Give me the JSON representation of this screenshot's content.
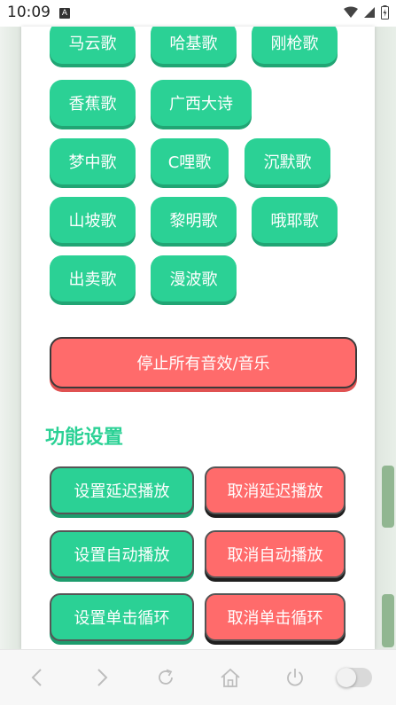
{
  "status_bar": {
    "time": "10:09",
    "notification_letter": "A"
  },
  "songs": [
    "马云歌",
    "哈基歌",
    "刚枪歌",
    "香蕉歌",
    "广西大诗",
    "梦中歌",
    "C哩歌",
    "沉默歌",
    "山坡歌",
    "黎明歌",
    "哦耶歌",
    "出卖歌",
    "漫波歌"
  ],
  "stop_all": "停止所有音效/音乐",
  "settings": {
    "title": "功能设置",
    "buttons": [
      {
        "set": "设置延迟播放",
        "cancel": "取消延迟播放"
      },
      {
        "set": "设置自动播放",
        "cancel": "取消自动播放"
      },
      {
        "set": "设置单击循环",
        "cancel": "取消单击循环"
      }
    ]
  },
  "nav_icons": [
    "back-icon",
    "forward-icon",
    "reload-icon",
    "home-icon",
    "power-icon",
    "toggle-switch"
  ],
  "colors": {
    "accent_green": "#2bd195",
    "accent_red": "#ff6b6b"
  }
}
